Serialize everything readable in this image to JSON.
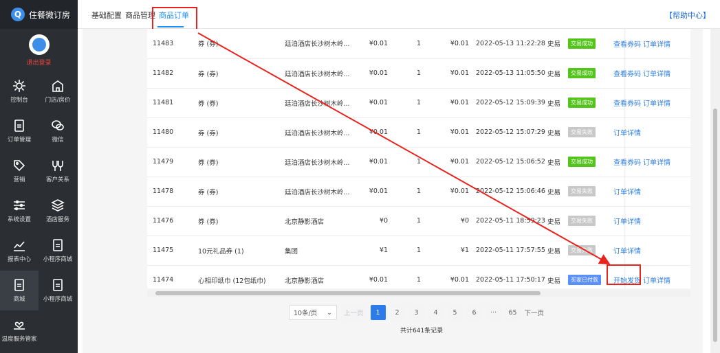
{
  "brand": {
    "name": "住餐微订房",
    "logout": "退出登录"
  },
  "nav": [
    {
      "label": "控制台",
      "icon": "gear-icon"
    },
    {
      "label": "门店/房价",
      "icon": "building-icon"
    },
    {
      "label": "订单管理",
      "icon": "document-icon"
    },
    {
      "label": "微信",
      "icon": "wechat-icon"
    },
    {
      "label": "营销",
      "icon": "tag-icon"
    },
    {
      "label": "客户关系",
      "icon": "people-icon"
    },
    {
      "label": "系统设置",
      "icon": "sliders-icon"
    },
    {
      "label": "酒店服务",
      "icon": "layers-icon"
    },
    {
      "label": "报表中心",
      "icon": "chart-icon"
    },
    {
      "label": "小程序商城",
      "icon": "document-icon"
    },
    {
      "label": "商城",
      "icon": "document-icon"
    },
    {
      "label": "小程序商城",
      "icon": "document-icon"
    },
    {
      "label": "温度服务管家",
      "icon": "heart-hand-icon"
    }
  ],
  "tabs": [
    "基础配置",
    "商品管理",
    "商品订单"
  ],
  "help": "【帮助中心】",
  "rows": [
    {
      "id": "11483",
      "name": "券 (券)",
      "shop": "廷泊酒店长沙树木岭...",
      "price": "¥0.01",
      "qty": "1",
      "total": "¥0.01",
      "time": "2022-05-13 11:22:28",
      "user": "史易",
      "status": "交易成功",
      "status_color": "#52c41a",
      "actions": [
        "查看券码",
        "订单详情"
      ]
    },
    {
      "id": "11482",
      "name": "券 (券)",
      "shop": "廷泊酒店长沙树木岭...",
      "price": "¥0.01",
      "qty": "1",
      "total": "¥0.01",
      "time": "2022-05-13 11:05:50",
      "user": "史易",
      "status": "交易成功",
      "status_color": "#52c41a",
      "actions": [
        "查看券码",
        "订单详情"
      ]
    },
    {
      "id": "11481",
      "name": "券 (券)",
      "shop": "廷泊酒店长沙树木岭...",
      "price": "¥0.01",
      "qty": "1",
      "total": "¥0.01",
      "time": "2022-05-12 15:09:39",
      "user": "史易",
      "status": "交易成功",
      "status_color": "#52c41a",
      "actions": [
        "查看券码",
        "订单详情"
      ]
    },
    {
      "id": "11480",
      "name": "券 (券)",
      "shop": "廷泊酒店长沙树木岭...",
      "price": "¥0.01",
      "qty": "1",
      "total": "¥0.01",
      "time": "2022-05-12 15:07:29",
      "user": "史易",
      "status": "交易失败",
      "status_color": "#c8c8c8",
      "actions": [
        "订单详情"
      ]
    },
    {
      "id": "11479",
      "name": "券 (券)",
      "shop": "廷泊酒店长沙树木岭...",
      "price": "¥0.01",
      "qty": "1",
      "total": "¥0.01",
      "time": "2022-05-12 15:06:52",
      "user": "史易",
      "status": "交易成功",
      "status_color": "#52c41a",
      "actions": [
        "查看券码",
        "订单详情"
      ]
    },
    {
      "id": "11478",
      "name": "券 (券)",
      "shop": "廷泊酒店长沙树木岭...",
      "price": "¥0.01",
      "qty": "1",
      "total": "¥0.01",
      "time": "2022-05-12 15:06:46",
      "user": "史易",
      "status": "交易失败",
      "status_color": "#c8c8c8",
      "actions": [
        "订单详情"
      ]
    },
    {
      "id": "11476",
      "name": "券 (券)",
      "shop": "北京静影酒店",
      "price": "¥0",
      "qty": "1",
      "total": "¥0",
      "time": "2022-05-11 18:59:23",
      "user": "史易",
      "status": "交易失败",
      "status_color": "#c8c8c8",
      "actions": [
        "订单详情"
      ]
    },
    {
      "id": "11475",
      "name": "10元礼品券 (1)",
      "shop": "集团",
      "price": "¥1",
      "qty": "1",
      "total": "¥1",
      "time": "2022-05-11 17:57:55",
      "user": "史易",
      "status": "交易失败",
      "status_color": "#c8c8c8",
      "actions": [
        "订单详情"
      ]
    },
    {
      "id": "11474",
      "name": "心相印纸巾 (12包纸巾)",
      "shop": "北京静影酒店",
      "price": "¥0.01",
      "qty": "1",
      "total": "¥0.01",
      "time": "2022-05-11 17:50:17",
      "user": "史易",
      "status": "买家已付款",
      "status_color": "#5b8ff9",
      "actions": [
        "开始发货",
        "订单详情"
      ]
    }
  ],
  "pager": {
    "size": "10条/页",
    "prev": "上一页",
    "pages": [
      "1",
      "2",
      "3",
      "4",
      "5",
      "6",
      "···",
      "65"
    ],
    "next": "下一页",
    "total": "共计641条记录"
  },
  "colors": {
    "accent": "#1e90ff",
    "highlight": "#e8231e",
    "sidebar": "#2b2e33"
  }
}
